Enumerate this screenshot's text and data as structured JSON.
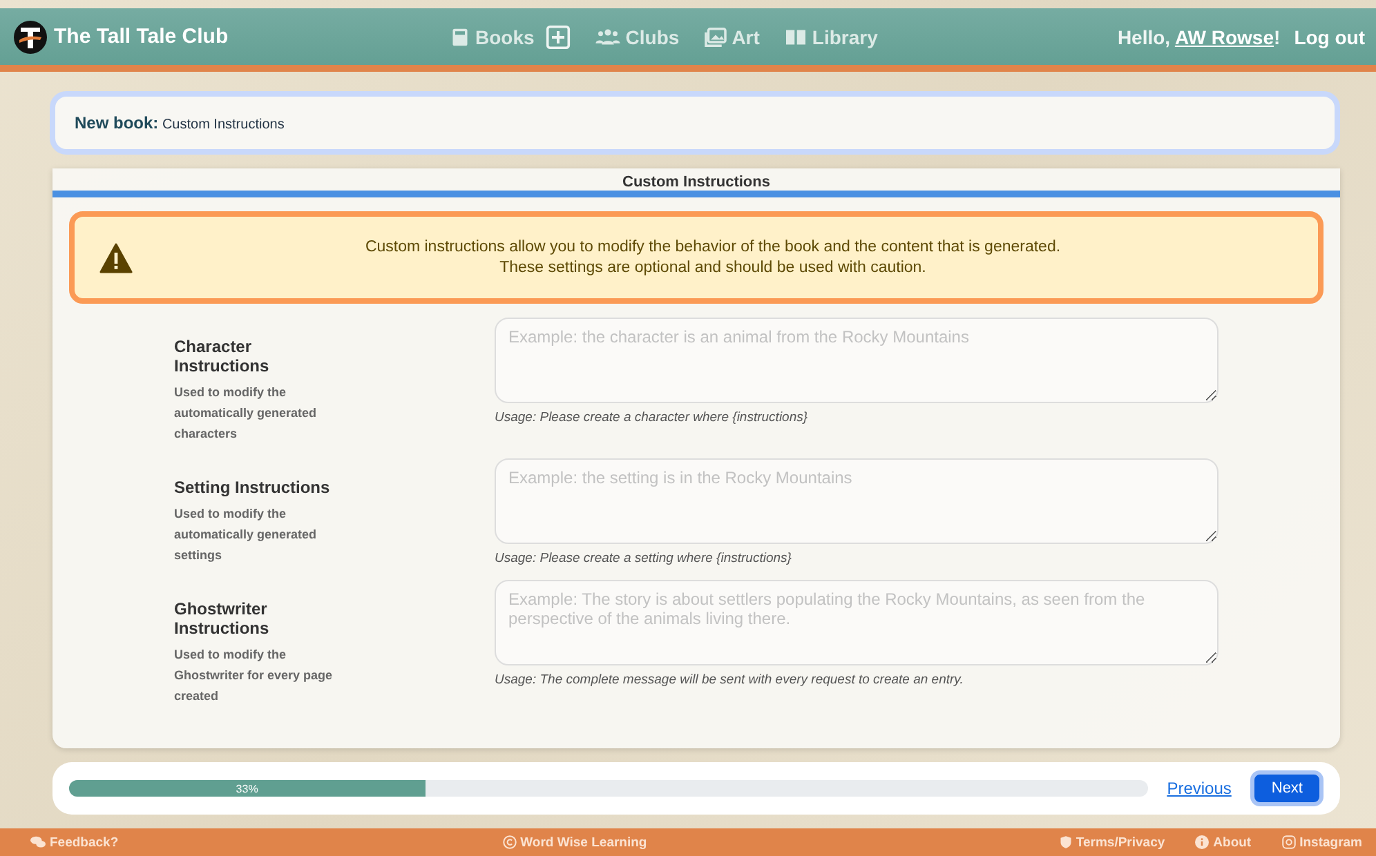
{
  "header": {
    "brand": "The Tall Tale Club",
    "nav": [
      {
        "kind": "books",
        "label": "Books"
      },
      {
        "kind": "add"
      },
      {
        "kind": "clubs",
        "label": "Clubs"
      },
      {
        "kind": "art",
        "label": "Art"
      },
      {
        "kind": "library",
        "label": "Library"
      }
    ],
    "greeting": "Hello, ",
    "user": "AW Rowse",
    "greeting_end": "!",
    "logout": "Log out"
  },
  "breadcrumb": {
    "label": "New book:",
    "page": "Custom Instructions"
  },
  "card": {
    "heading": "Custom Instructions",
    "alert": [
      "Custom instructions allow you to modify the behavior of the book and the content that is generated.",
      "These settings are optional and should be used with caution."
    ],
    "fields": [
      {
        "title": "Character Instructions",
        "description": "Used to modify the automatically generated characters",
        "placeholder": "Example: the character is an animal from the Rocky Mountains",
        "usage": "Usage: Please create a character where {instructions}"
      },
      {
        "title": "Setting Instructions",
        "description": "Used to modify the automatically generated settings",
        "placeholder": "Example: the setting is in the Rocky Mountains",
        "usage": "Usage: Please create a setting where {instructions}"
      },
      {
        "title": "Ghostwriter Instructions",
        "description": "Used to modify the Ghostwriter for every page created",
        "placeholder": "Example: The story is about settlers populating the Rocky Mountains, as seen from the perspective of the animals living there.",
        "usage": "Usage: The complete message will be sent with every request to create an entry."
      }
    ]
  },
  "progress": {
    "level": 0.33,
    "label": "33%",
    "previous": "Previous",
    "next": "Next"
  },
  "footer": [
    {
      "kind": "feedback",
      "label": "Feedback?"
    },
    {
      "kind": "copyright",
      "label": "Word Wise Learning"
    },
    {
      "kind": "terms",
      "label": "Terms/Privacy"
    },
    {
      "kind": "about",
      "label": "About"
    },
    {
      "kind": "instagram",
      "label": "Instagram"
    }
  ]
}
